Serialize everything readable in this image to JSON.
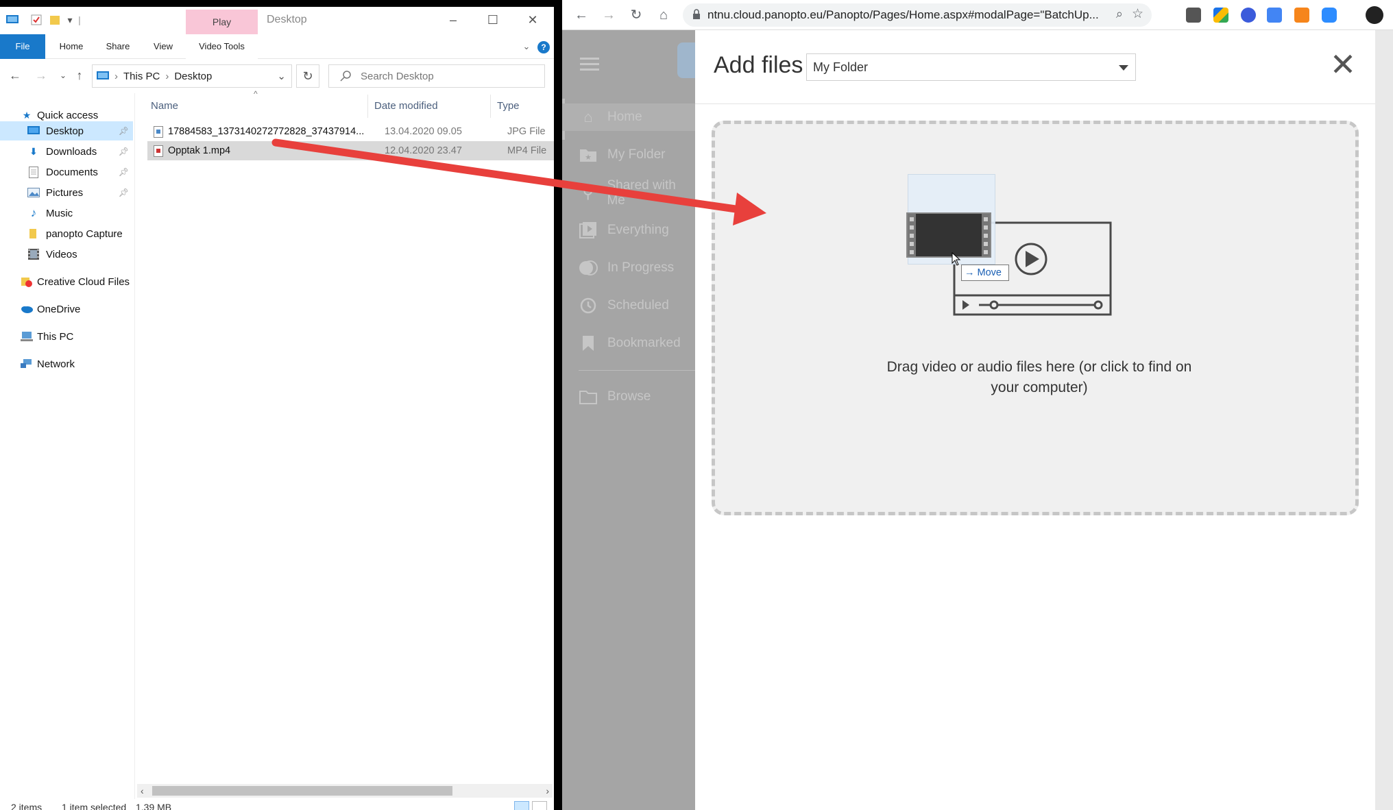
{
  "explorer": {
    "title": "Desktop",
    "context_tab": "Play",
    "ribbon_tabs": [
      "File",
      "Home",
      "Share",
      "View",
      "Video Tools"
    ],
    "breadcrumb": [
      "This PC",
      "Desktop"
    ],
    "search_placeholder": "Search Desktop",
    "nav": {
      "quick_access": "Quick access",
      "items": [
        {
          "label": "Desktop",
          "icon": "desktop-icon",
          "pinned": true
        },
        {
          "label": "Downloads",
          "icon": "downloads-icon",
          "pinned": true
        },
        {
          "label": "Documents",
          "icon": "documents-icon",
          "pinned": true
        },
        {
          "label": "Pictures",
          "icon": "pictures-icon",
          "pinned": true
        },
        {
          "label": "Music",
          "icon": "music-icon",
          "pinned": false
        },
        {
          "label": "panopto Capture",
          "icon": "folder-icon",
          "pinned": false
        },
        {
          "label": "Videos",
          "icon": "videos-icon",
          "pinned": false
        }
      ],
      "creative_cloud": "Creative Cloud Files",
      "onedrive": "OneDrive",
      "this_pc": "This PC",
      "network": "Network"
    },
    "columns": {
      "name": "Name",
      "date": "Date modified",
      "type": "Type"
    },
    "files": [
      {
        "name": "17884583_1373140272772828_37437914...",
        "date": "13.04.2020 09.05",
        "type": "JPG File"
      },
      {
        "name": "Opptak 1.mp4",
        "date": "12.04.2020 23.47",
        "type": "MP4 File"
      }
    ],
    "status": {
      "count": "2 items",
      "selected": "1 item selected",
      "size": "1,39 MB"
    }
  },
  "browser": {
    "url": "ntnu.cloud.panopto.eu/Panopto/Pages/Home.aspx#modalPage=\"BatchUp...",
    "sidebar": [
      {
        "label": "Home",
        "icon": "home-icon"
      },
      {
        "label": "My Folder",
        "icon": "my-folder-icon"
      },
      {
        "label": "Shared with Me",
        "icon": "share-icon"
      },
      {
        "label": "Everything",
        "icon": "everything-icon"
      },
      {
        "label": "In Progress",
        "icon": "in-progress-icon"
      },
      {
        "label": "Scheduled",
        "icon": "clock-icon"
      },
      {
        "label": "Bookmarked",
        "icon": "bookmark-icon"
      },
      {
        "label": "Browse",
        "icon": "folder-icon"
      }
    ],
    "modal": {
      "title": "Add files to",
      "folder": "My Folder",
      "drop_text": "Drag video or audio files here (or click to find on your computer)",
      "drag_tooltip": "Move"
    }
  },
  "colors": {
    "accent": "#1979ca",
    "selection": "#cce8ff",
    "arrow": "#e8403c"
  }
}
